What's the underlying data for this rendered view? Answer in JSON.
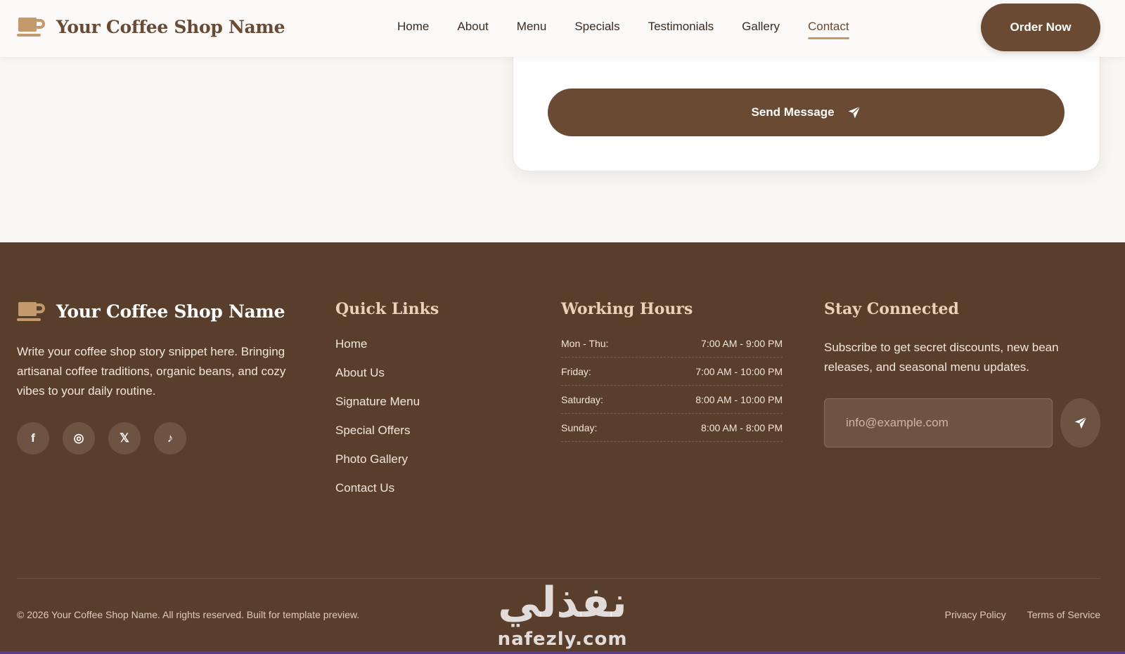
{
  "header": {
    "brand_name": "Your Coffee Shop Name",
    "nav": [
      {
        "label": "Home"
      },
      {
        "label": "About"
      },
      {
        "label": "Menu"
      },
      {
        "label": "Specials"
      },
      {
        "label": "Testimonials"
      },
      {
        "label": "Gallery"
      },
      {
        "label": "Contact",
        "active": true
      }
    ],
    "order_button": "Order Now"
  },
  "contact_form": {
    "send_button": "Send Message",
    "send_icon": "paper-plane-icon"
  },
  "footer": {
    "brand_name": "Your Coffee Shop Name",
    "description": "Write your coffee shop story snippet here. Bringing artisanal coffee traditions, organic beans, and cozy vibes to your daily routine.",
    "socials": [
      {
        "name": "facebook-icon",
        "glyph": "f"
      },
      {
        "name": "instagram-icon",
        "glyph": "◎"
      },
      {
        "name": "x-icon",
        "glyph": "𝕏"
      },
      {
        "name": "tiktok-icon",
        "glyph": "♪"
      }
    ],
    "quick_links": {
      "title": "Quick Links",
      "items": [
        "Home",
        "About Us",
        "Signature Menu",
        "Special Offers",
        "Photo Gallery",
        "Contact Us"
      ]
    },
    "working_hours": {
      "title": "Working Hours",
      "rows": [
        {
          "day": "Mon - Thu:",
          "time": "7:00 AM - 9:00 PM"
        },
        {
          "day": "Friday:",
          "time": "7:00 AM - 10:00 PM"
        },
        {
          "day": "Saturday:",
          "time": "8:00 AM - 10:00 PM"
        },
        {
          "day": "Sunday:",
          "time": "8:00 AM - 8:00 PM"
        }
      ]
    },
    "stay_connected": {
      "title": "Stay Connected",
      "description": "Subscribe to get secret discounts, new bean releases, and seasonal menu updates.",
      "email_placeholder": "info@example.com"
    },
    "copyright": "© 2026 Your Coffee Shop Name. All rights reserved. Built for template preview.",
    "legal": [
      "Privacy Policy",
      "Terms of Service"
    ],
    "watermark": {
      "logo": "نفذلي",
      "text": "nafezly.com"
    }
  },
  "colors": {
    "brand": "#6b4a33",
    "accent": "#c49a6c",
    "footer_bg": "#5a3e2c"
  }
}
